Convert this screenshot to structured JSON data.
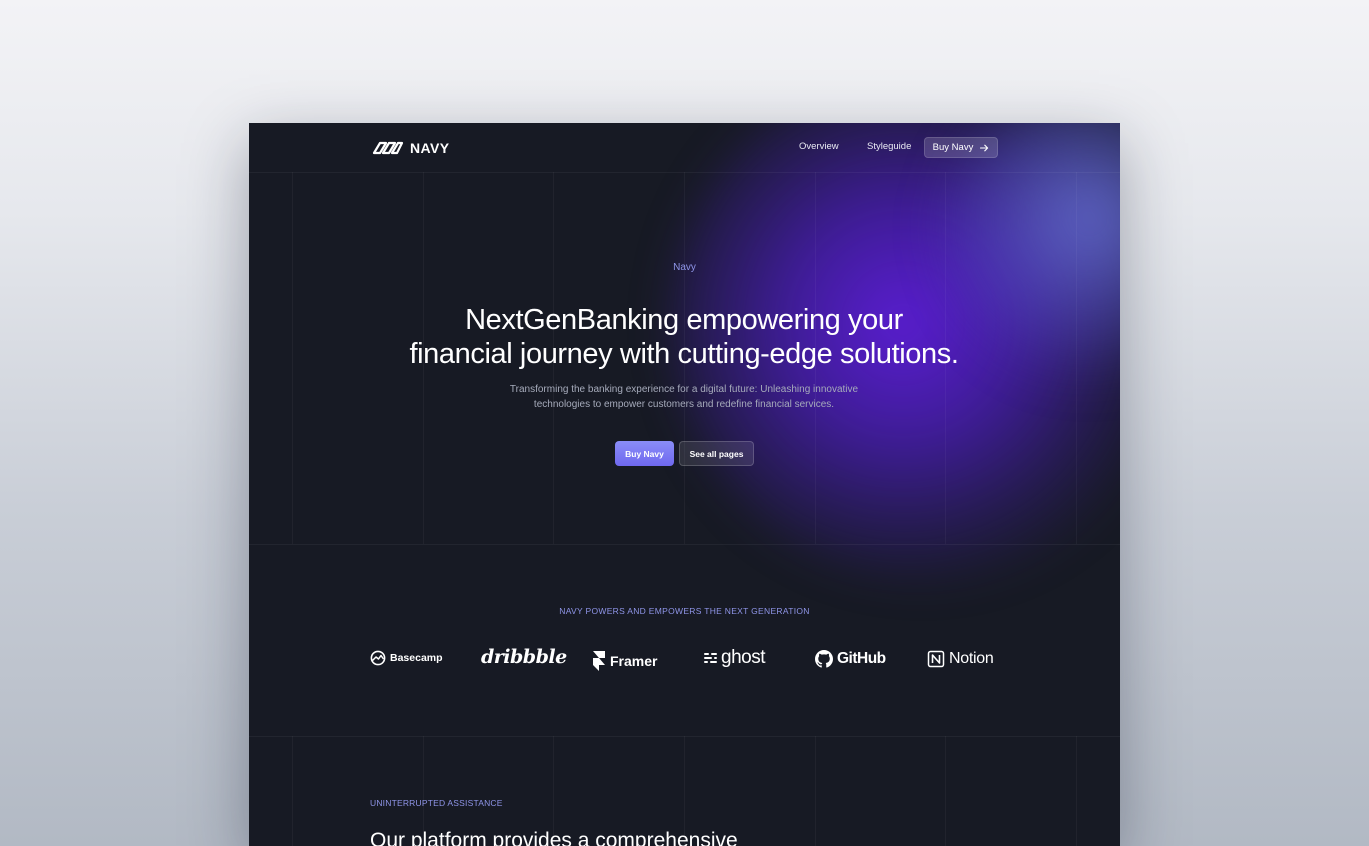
{
  "nav": {
    "brand": "NAVY",
    "links": [
      "Overview",
      "Styleguide"
    ],
    "cta_label": "Buy Navy",
    "cta_icon": "arrow-right-icon"
  },
  "hero": {
    "eyebrow": "Navy",
    "title_line1": "NextGenBanking empowering your",
    "title_line2": "financial journey with cutting-edge solutions.",
    "subtitle_line1": "Transforming the banking experience for a digital future: Unleashing innovative",
    "subtitle_line2": "technologies to empower customers and redefine financial services.",
    "primary_button": "Buy Navy",
    "secondary_button": "See all pages"
  },
  "logos": {
    "heading": "NAVY POWERS AND EMPOWERS THE NEXT GENERATION",
    "brands": [
      "Basecamp",
      "dribbble",
      "Framer",
      "ghost",
      "GitHub",
      "Notion"
    ]
  },
  "assistance": {
    "eyebrow": "UNINTERRUPTED ASSISTANCE",
    "title": "Our platform provides a comprehensive"
  },
  "colors": {
    "background": "#171a24",
    "accent": "#8f95e8",
    "primary_button": "#7b7af3",
    "glow": "#5f1edc"
  }
}
